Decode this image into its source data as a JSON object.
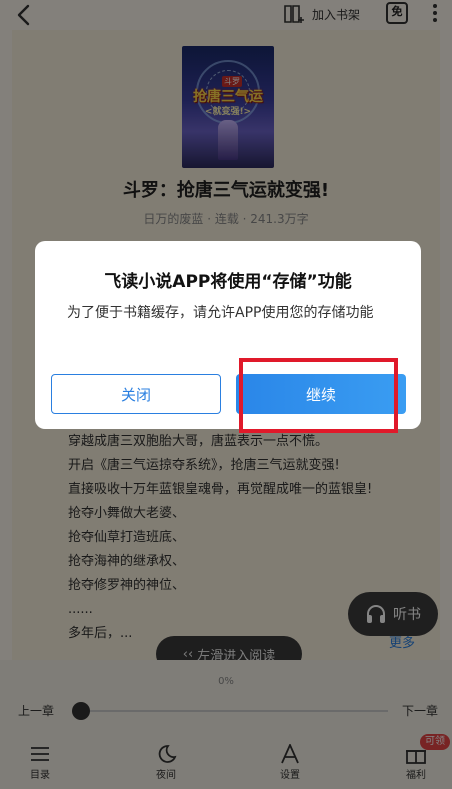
{
  "topbar": {
    "add_shelf_label": "加入书架",
    "free_badge": "免"
  },
  "book": {
    "cover_tag": "斗罗",
    "cover_title": "抢唐三气运",
    "cover_subtitle": "<就变强!>",
    "title": "斗罗：抢唐三气运就变强!",
    "meta": "日万的废蓝 · 连载 · 241.3万字"
  },
  "synopsis": {
    "lines": [
      "穿越成唐三双胞胎大哥，唐蓝表示一点不慌。",
      "开启《唐三气运掠夺系统》，抢唐三气运就变强!",
      "直接吸收十万年蓝银皇魂骨，再觉醒成唯一的蓝银皇!",
      "抢夺小舞做大老婆、",
      "抢夺仙草打造班底、",
      "抢夺海神的继承权、",
      "抢夺修罗神的神位、",
      "......",
      "多年后，..."
    ],
    "more_label": "更多"
  },
  "listen": {
    "label": "听书"
  },
  "swipe_hint": "左滑进入阅读",
  "reader_controls": {
    "progress": "0%",
    "prev_chapter": "上一章",
    "next_chapter": "下一章"
  },
  "tabs": [
    {
      "label": "目录",
      "icon": "list-icon"
    },
    {
      "label": "夜间",
      "icon": "moon-icon"
    },
    {
      "label": "设置",
      "icon": "font-icon"
    },
    {
      "label": "福利",
      "icon": "gift-icon",
      "badge": "可领"
    }
  ],
  "dialog": {
    "title": "飞读小说APP将使用“存储”功能",
    "body": "为了便于书籍缓存，请允许APP使用您的存储功能",
    "close_label": "关闭",
    "continue_label": "继续"
  },
  "colors": {
    "accent": "#2a7fe0",
    "highlight": "#e0192a",
    "badge": "#e64545"
  }
}
